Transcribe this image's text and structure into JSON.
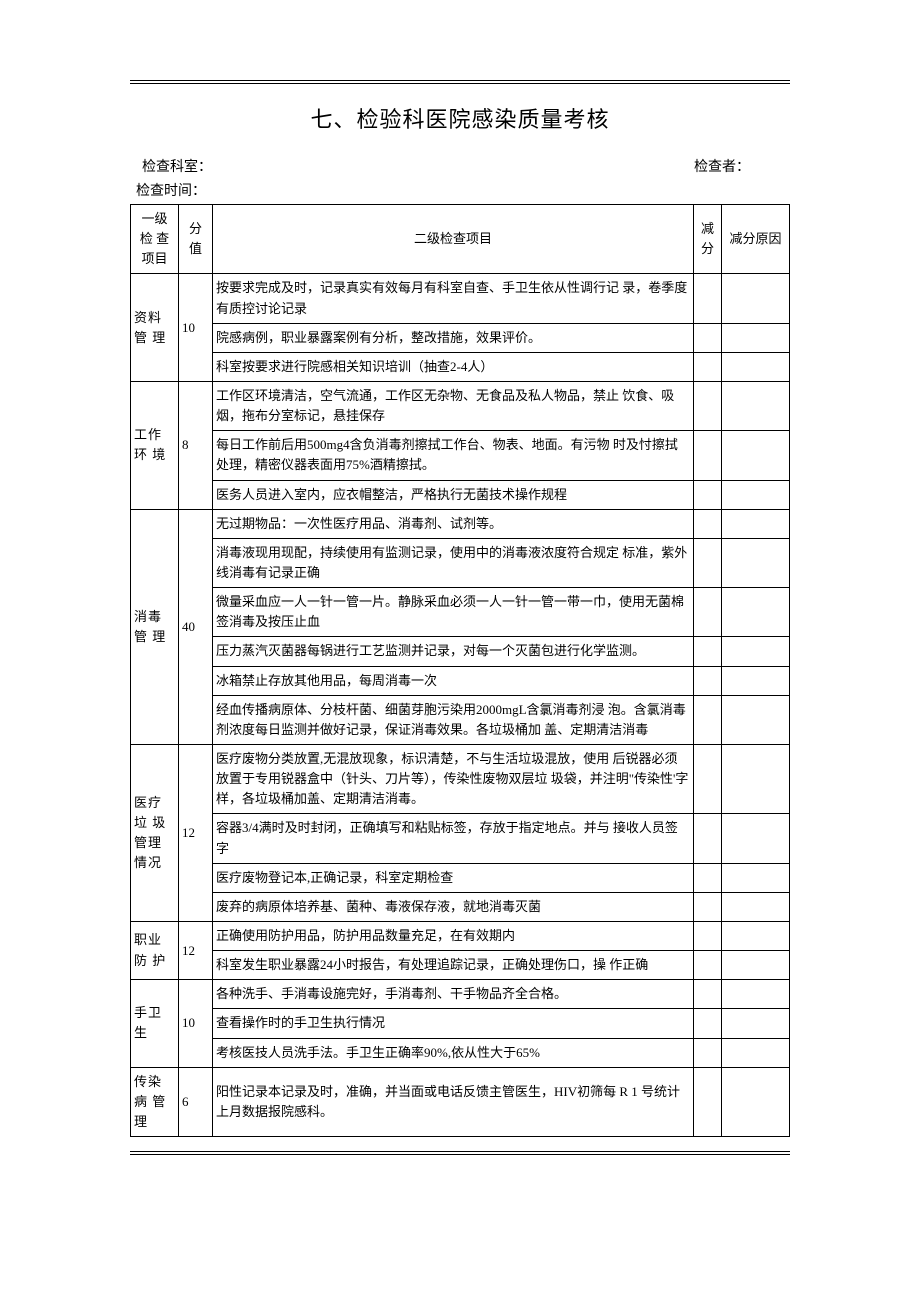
{
  "title": "七、检验科医院感染质量考核",
  "meta": {
    "dept_label": "检查科室：",
    "checker_label": "检查者：",
    "time_label": "检查时间："
  },
  "headers": {
    "category": "一级 检 查 项目",
    "score": "分 值",
    "item": "二级检查项目",
    "deduct": "减 分",
    "reason": "减分原因"
  },
  "sections": [
    {
      "category": "资料 管 理",
      "score": "10",
      "items": [
        "按要求完成及时，记录真实有效每月有科室自查、手卫生依从性调行记 录，卷季度有质控讨论记录",
        "院感病例，职业暴露案例有分析，整改措施，效果评价。",
        "科室按要求进行院感相关知识培训（抽查2-4人）"
      ]
    },
    {
      "category": "工作 环 境",
      "score": "8",
      "items": [
        "工作区环境清洁，空气流通，工作区无杂物、无食品及私人物品，禁止 饮食、吸烟，拖布分室标记，悬挂保存",
        "每日工作前后用500mg4含负消毒剂擦拭工作台、物表、地面。有污物 时及忖擦拭处理，精密仪器表面用75%酒精擦拭。",
        "医务人员进入室内，应衣帽整洁，严格执行无菌技术操作规程"
      ]
    },
    {
      "category": "消毒 管 理",
      "score": "40",
      "items": [
        "无过期物品：一次性医疗用品、消毒剂、试剂等。",
        "消毒液现用现配，持续使用有监测记录，使用中的消毒液浓度符合规定 标准，紫外线消毒有记录正确",
        "微量采血应一人一针一管一片。静脉采血必须一人一针一管一带一巾，使用无菌棉签消毒及按压止血",
        "压力蒸汽灭菌器每锅进行工艺监测并记录，对每一个灭菌包进行化学监测。",
        "冰箱禁止存放其他用品，每周消毒一次",
        "经血传播病原体、分枝杆菌、细菌芽胞污染用2000mgL含氯消毒剂浸 泡。含氯消毒剂浓度每日监测并做好记录，保证消毒效果。各垃圾桶加 盖、定期清洁消毒"
      ]
    },
    {
      "category": "医疗 垃 圾 管理 情况",
      "score": "12",
      "items": [
        "医疗废物分类放置,无混放现象，标识清楚，不与生活垃圾混放，使用 后锐器必须放置于专用锐器盒中（针头、刀片等），传染性废物双层垃 圾袋，并注明\"传染性'字样，各垃圾桶加盖、定期清洁消毒。",
        "容器3/4满时及时封闭，正确填写和粘贴标签，存放于指定地点。并与 接收人员签字",
        "医疗废物登记本,正确记录，科室定期检查",
        "废弃的病原体培养基、菌种、毒液保存液，就地消毒灭菌"
      ]
    },
    {
      "category": "职业 防 护",
      "score": "12",
      "items": [
        "正确使用防护用品，防护用品数量充足，在有效期内",
        "科室发生职业暴露24小时报告，有处理追踪记录，正确处理伤口，操 作正确"
      ]
    },
    {
      "category": "手卫 生",
      "score": "10",
      "items": [
        "各种洗手、手消毒设施完好，手消毒剂、干手物品齐全合格。",
        "查看操作时的手卫生执行情况",
        "考核医技人员洗手法。手卫生正确率90%,依从性大于65%"
      ]
    },
    {
      "category": "传染 病 管 理",
      "score": "6",
      "items": [
        "阳性记录本记录及时，准确，并当面或电话反馈主管医生，HIV初筛每 R 1 号统计上月数据报院感科。"
      ]
    }
  ]
}
